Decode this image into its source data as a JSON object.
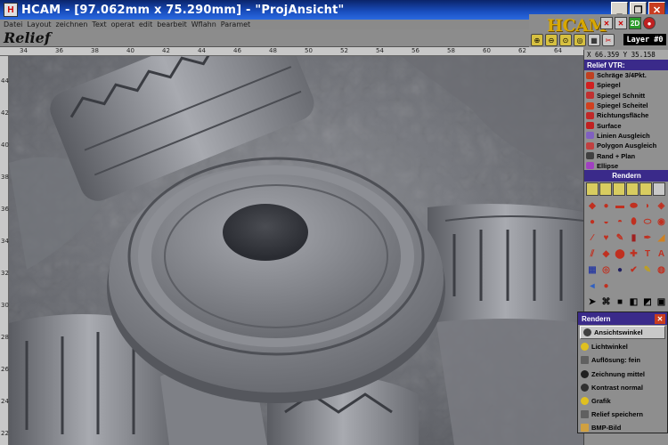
{
  "window": {
    "title": "HCAM - [97.062mm x 75.290mm] - \"ProjAnsicht\"",
    "icon": "hcam-app-icon"
  },
  "menu": [
    "Datei",
    "Layout",
    "zeichnen",
    "Text",
    "operat",
    "edit",
    "bearbeit",
    "Wflahn",
    "Paramet"
  ],
  "header": {
    "view_title": "Relief",
    "logo": "HCAM",
    "badge_2d": "2D",
    "layer": "Layer #0"
  },
  "rulers": {
    "top": [
      "34",
      "36",
      "38",
      "40",
      "42",
      "44",
      "46",
      "48",
      "50",
      "52",
      "54",
      "56",
      "58",
      "60",
      "62",
      "64"
    ],
    "left": [
      "44",
      "42",
      "40",
      "38",
      "36",
      "34",
      "32",
      "30",
      "28",
      "26",
      "24",
      "22"
    ]
  },
  "panel": {
    "coords": "X 66.359 Y 35.158",
    "list_title": "Relief VTR:",
    "items": [
      {
        "label": "Schräge 3/4Pkt.",
        "color": "#c04020"
      },
      {
        "label": "Spiegel",
        "color": "#d02020"
      },
      {
        "label": "Spiegel Schnitt",
        "color": "#c03030"
      },
      {
        "label": "Spiegel Scheitel",
        "color": "#d04020"
      },
      {
        "label": "Richtungsfläche",
        "color": "#c02828"
      },
      {
        "label": "Surface",
        "color": "#c02020"
      },
      {
        "label": "Linien Ausgleich",
        "color": "#8060c0"
      },
      {
        "label": "Polygon Ausgleich",
        "color": "#c04040"
      },
      {
        "label": "Rand + Plan",
        "color": "#404040"
      },
      {
        "label": "Ellipse",
        "color": "#a040c0"
      }
    ],
    "render_title": "Rendern"
  },
  "popup": {
    "title": "Rendern",
    "items": [
      {
        "label": "Ansichtswinkel",
        "color": "#404040"
      },
      {
        "label": "Lichtwinkel",
        "color": "#e0c020"
      },
      {
        "label": "Auflösung:     fein",
        "color": "#606060"
      },
      {
        "label": "Zeichnung mittel",
        "color": "#202020"
      },
      {
        "label": "Kontrast   normal",
        "color": "#303030"
      },
      {
        "label": "Grafik",
        "color": "#e0c020"
      },
      {
        "label": "Relief speichern",
        "color": "#606060"
      },
      {
        "label": "BMP-Bild",
        "color": "#d0a040"
      }
    ]
  }
}
